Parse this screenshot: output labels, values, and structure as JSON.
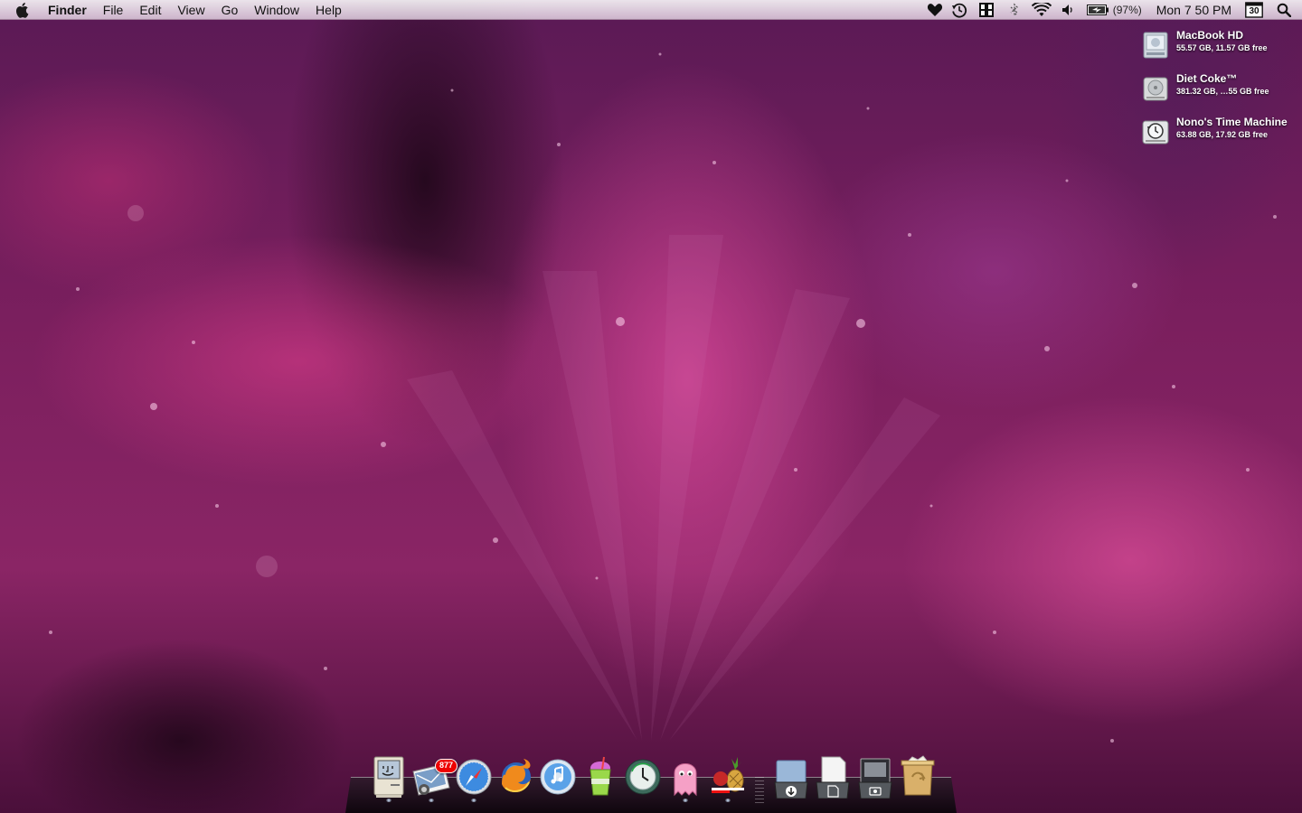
{
  "menubar": {
    "apple_icon": "apple-logo-icon",
    "app_name": "Finder",
    "menus": [
      "File",
      "Edit",
      "View",
      "Go",
      "Window",
      "Help"
    ],
    "status_icons": [
      "heart-icon",
      "time-machine-icon",
      "spaces-icon",
      "bluetooth-icon",
      "wifi-icon",
      "volume-icon",
      "battery-icon"
    ],
    "battery_percent": "(97%)",
    "clock": "Mon 7 50 PM",
    "calendar_day": "30",
    "spotlight_icon": "spotlight-search-icon"
  },
  "desktop": {
    "volumes": [
      {
        "name": "MacBook HD",
        "info": "55.57 GB, 11.57 GB free",
        "icon": "internal-drive-icon"
      },
      {
        "name": "Diet Coke™",
        "info": "381.32 GB, …55 GB free",
        "icon": "external-drive-icon"
      },
      {
        "name": "Nono's Time Machine",
        "info": "63.88 GB, 17.92 GB free",
        "icon": "time-machine-drive-icon"
      }
    ]
  },
  "dock": {
    "apps": [
      {
        "name": "Finder",
        "icon": "classic-mac-finder-icon",
        "running": true
      },
      {
        "name": "Mail",
        "icon": "mail-stamp-icon",
        "running": true,
        "badge": "877"
      },
      {
        "name": "Safari",
        "icon": "safari-compass-icon",
        "running": true
      },
      {
        "name": "Firefox",
        "icon": "firefox-icon",
        "running": false
      },
      {
        "name": "iTunes",
        "icon": "itunes-icon",
        "running": false
      },
      {
        "name": "Slurpee",
        "icon": "slurpee-cup-icon",
        "running": false
      },
      {
        "name": "Time Machine",
        "icon": "time-machine-icon",
        "running": false
      },
      {
        "name": "Ghost",
        "icon": "pink-ghost-icon",
        "running": true
      },
      {
        "name": "Desktop Pet",
        "icon": "pineapple-icon",
        "running": true
      }
    ],
    "stacks": [
      {
        "name": "Downloads",
        "icon": "downloads-stack-icon"
      },
      {
        "name": "Documents",
        "icon": "documents-stack-icon"
      },
      {
        "name": "Screenshots",
        "icon": "screenshots-stack-icon"
      },
      {
        "name": "Trash",
        "icon": "trash-icon"
      }
    ],
    "colors": {
      "badge": "#ee0000",
      "running_light": "#cfe6ff"
    }
  }
}
